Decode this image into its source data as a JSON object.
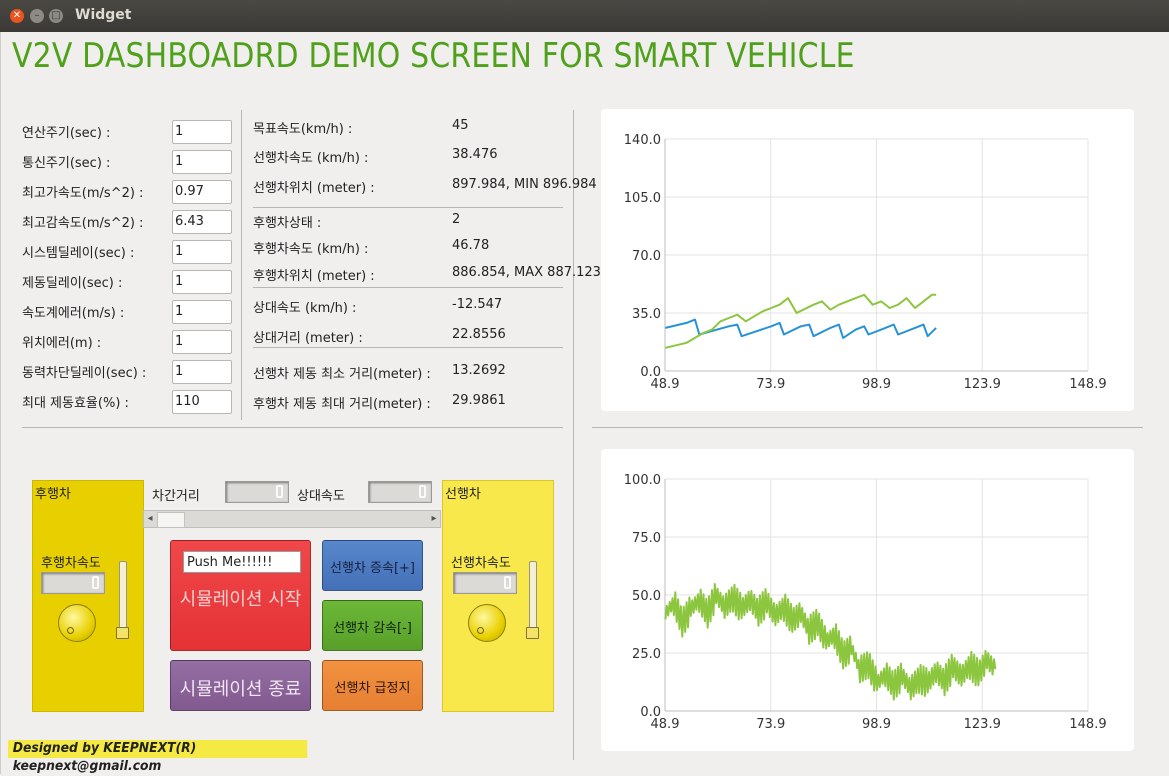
{
  "window": {
    "title": "Widget"
  },
  "headline": "V2V DASHBOADRD DEMO SCREEN FOR SMART VEHICLE",
  "params": [
    {
      "label": "연산주기(sec) :",
      "value": "1"
    },
    {
      "label": "통신주기(sec) :",
      "value": "1"
    },
    {
      "label": "최고가속도(m/s^2) :",
      "value": "0.97"
    },
    {
      "label": "최고감속도(m/s^2) :",
      "value": "6.43"
    },
    {
      "label": "시스템딜레이(sec) :",
      "value": "1"
    },
    {
      "label": "제동딜레이(sec) :",
      "value": "1"
    },
    {
      "label": "속도계에러(m/s) :",
      "value": "1"
    },
    {
      "label": "위치에러(m) :",
      "value": "1"
    },
    {
      "label": "동력차단딜레이(sec) :",
      "value": "1"
    },
    {
      "label": "최대 제동효율(%) :",
      "value": "110"
    }
  ],
  "info": [
    {
      "label": "목표속도(km/h) :",
      "value": "45"
    },
    {
      "label": "선행차속도 (km/h) :",
      "value": "38.476"
    },
    {
      "label": "선행차위치 (meter) :",
      "value": "897.984, MIN 896.984"
    },
    {
      "label": "후행차상태 :",
      "value": "2"
    },
    {
      "label": "후행차속도 (km/h) :",
      "value": "46.78"
    },
    {
      "label": "후행차위치 (meter) :",
      "value": "886.854, MAX 887.123"
    },
    {
      "label": "상대속도 (km/h) :",
      "value": "-12.547"
    },
    {
      "label": "상대거리 (meter) :",
      "value": "22.8556"
    },
    {
      "label": "선행차 제동 최소 거리(meter) :",
      "value": "13.2692"
    },
    {
      "label": "후행차 제동 최대 거리(meter) :",
      "value": "29.9861"
    }
  ],
  "controls": {
    "follower_title": "후행차",
    "follower_speed_label": "후행차속도",
    "leader_title": "선행차",
    "leader_speed_label": "선행차속도",
    "gap_label": "차간거리",
    "rel_speed_label": "상대속도",
    "gap_display": "0",
    "rel_speed_display": "0",
    "follower_speed_display": "0",
    "leader_speed_display": "0",
    "scroll_left": "◂",
    "scroll_right": "▸",
    "push_input": "Push Me!!!!!!",
    "start_button": "시뮬레이션 시작",
    "stop_button": "시뮬레이션 종료",
    "accel_button": "선행차 증속[+]",
    "decel_button": "선행차 감속[-]",
    "estop_button": "선행차 급정지"
  },
  "colors": {
    "headline": "#4fa01a",
    "start": "#ee3a3e",
    "stop": "#8b6498",
    "accel": "#4d78bf",
    "decel": "#63ad32",
    "estop": "#ec883a",
    "follower_panel": "#e8d000",
    "leader_panel": "#f9e84c",
    "series_blue": "#2793d6",
    "series_green": "#8cc63f"
  },
  "signature": "Designed by KEEPNEXT(R) keepnext@gmail.com",
  "chart_data": [
    {
      "type": "line",
      "x_ticks": [
        "48.9",
        "73.9",
        "98.9",
        "123.9",
        "148.9"
      ],
      "y_ticks": [
        "0.0",
        "35.0",
        "70.0",
        "105.0",
        "140.0"
      ],
      "xlim": [
        48.9,
        148.9
      ],
      "ylim": [
        0,
        140
      ],
      "grid": true,
      "series": [
        {
          "color": "#2793d6",
          "x": [
            49,
            54,
            56,
            57,
            64,
            66,
            67,
            74,
            76,
            77,
            81,
            83,
            84,
            88,
            90,
            91,
            94,
            96,
            97,
            101,
            103,
            104,
            108,
            110,
            111,
            113
          ],
          "y": [
            26,
            29,
            31,
            22,
            27,
            28,
            21,
            27,
            29,
            22,
            27,
            28,
            21,
            26,
            28,
            20,
            25,
            27,
            22,
            26,
            28,
            22,
            26,
            28,
            21,
            26
          ]
        },
        {
          "color": "#8cc63f",
          "x": [
            49,
            54,
            58,
            60,
            62,
            64,
            66,
            68,
            72,
            74,
            76,
            78,
            80,
            84,
            86,
            88,
            90,
            94,
            96,
            98,
            100,
            102,
            104,
            106,
            108,
            110,
            112,
            113
          ],
          "y": [
            14,
            17,
            23,
            25,
            30,
            32,
            34,
            30,
            36,
            38,
            40,
            44,
            35,
            40,
            42,
            37,
            40,
            44,
            46,
            40,
            42,
            38,
            40,
            44,
            38,
            42,
            46,
            46
          ]
        }
      ]
    },
    {
      "type": "line",
      "x_ticks": [
        "48.9",
        "73.9",
        "98.9",
        "123.9",
        "148.9"
      ],
      "y_ticks": [
        "0.0",
        "25.0",
        "50.0",
        "75.0",
        "100.0"
      ],
      "xlim": [
        48.9,
        148.9
      ],
      "ylim": [
        0,
        100
      ],
      "grid": true,
      "series": [
        {
          "color": "#8cc63f",
          "x": [
            49,
            51,
            53,
            55,
            57,
            59,
            61,
            63,
            65,
            67,
            69,
            71,
            73,
            75,
            77,
            79,
            81,
            83,
            85,
            87,
            89,
            91,
            93,
            95,
            97,
            99,
            101,
            103,
            105,
            107,
            109,
            111,
            113,
            115,
            117,
            119,
            121,
            123,
            125,
            127
          ],
          "y": [
            42,
            47,
            38,
            44,
            48,
            42,
            50,
            45,
            49,
            44,
            48,
            43,
            47,
            41,
            45,
            39,
            42,
            35,
            38,
            30,
            33,
            24,
            27,
            18,
            20,
            12,
            16,
            11,
            15,
            10,
            14,
            12,
            17,
            13,
            19,
            15,
            20,
            16,
            22,
            18
          ],
          "amp": 2.5
        }
      ]
    }
  ]
}
